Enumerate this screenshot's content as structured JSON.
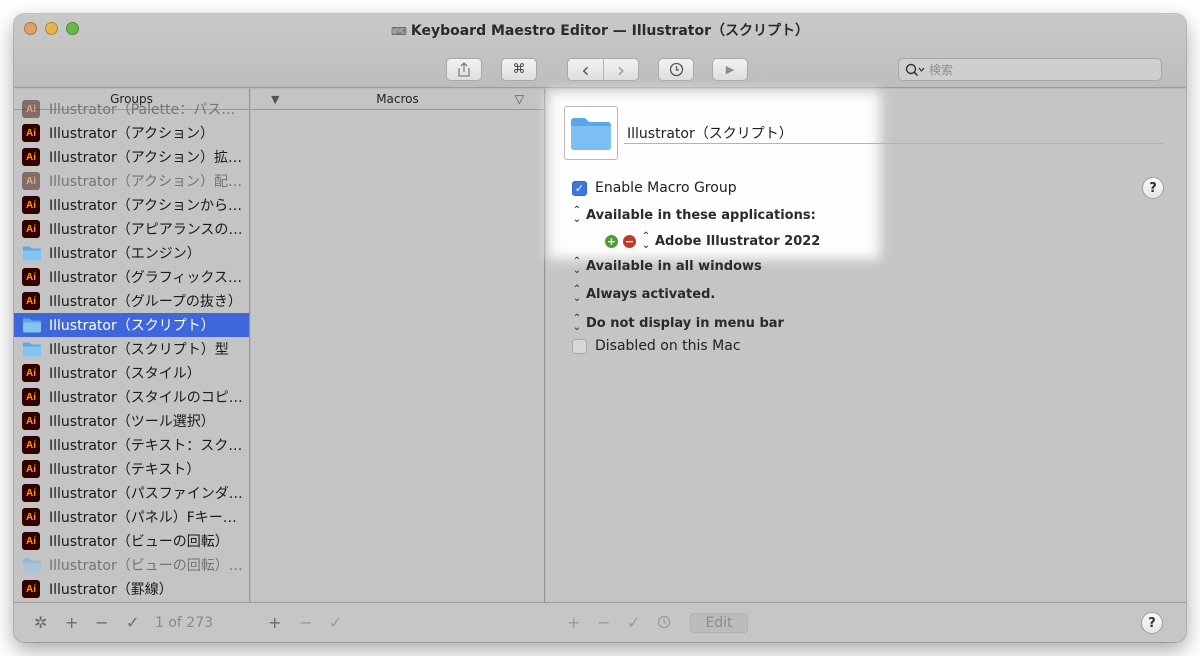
{
  "window": {
    "title": "Keyboard Maestro Editor — Illustrator（スクリプト）"
  },
  "toolbar": {
    "share_icon": "share-icon",
    "command_icon": "⌘",
    "back_icon": "‹",
    "forward_icon": "›",
    "clock_icon": "clock-icon",
    "run_icon": "▶",
    "search_placeholder": "検索"
  },
  "groups": {
    "header": "Groups",
    "items": [
      {
        "label": "Illustrator（Palette：パス操作）",
        "icon": "ai",
        "dim": true
      },
      {
        "label": "Illustrator（アクション）",
        "icon": "ai"
      },
      {
        "label": "Illustrator（アクション）拡大…",
        "icon": "ai"
      },
      {
        "label": "Illustrator（アクション）配布用",
        "icon": "ai",
        "dim": true
      },
      {
        "label": "Illustrator（アクションからの脱…",
        "icon": "ai"
      },
      {
        "label": "Illustrator（アピアランスのコピ…",
        "icon": "ai"
      },
      {
        "label": "Illustrator（エンジン）",
        "icon": "folder"
      },
      {
        "label": "Illustrator（グラフィックスタイ…",
        "icon": "ai"
      },
      {
        "label": "Illustrator（グループの抜き）",
        "icon": "ai"
      },
      {
        "label": "Illustrator（スクリプト）",
        "icon": "folder",
        "selected": true
      },
      {
        "label": "Illustrator（スクリプト）型",
        "icon": "folder"
      },
      {
        "label": "Illustrator（スタイル）",
        "icon": "ai"
      },
      {
        "label": "Illustrator（スタイルのコピー&…",
        "icon": "ai"
      },
      {
        "label": "Illustrator（ツール選択）",
        "icon": "ai"
      },
      {
        "label": "Illustrator（テキスト：スクリプ…",
        "icon": "ai"
      },
      {
        "label": "Illustrator（テキスト）",
        "icon": "ai"
      },
      {
        "label": "Illustrator（パスファインダー）",
        "icon": "ai"
      },
      {
        "label": "Illustrator（パネル）Fキー代替",
        "icon": "ai"
      },
      {
        "label": "Illustrator（ビューの回転）",
        "icon": "ai"
      },
      {
        "label": "Illustrator（ビューの回転）ba…",
        "icon": "folder",
        "dim": true
      },
      {
        "label": "Illustrator（罫線）",
        "icon": "ai"
      }
    ],
    "ai_badge": "Ai"
  },
  "macros": {
    "header": "Macros",
    "left_glyph": "▼",
    "right_glyph": "▽"
  },
  "editor": {
    "group_name": "Illustrator（スクリプト）",
    "enable_label": "Enable Macro Group",
    "enable_checked": true,
    "available_apps_label": "Available in these applications:",
    "app_name": "Adobe Illustrator 2022",
    "windows_label": "Available in all windows",
    "activation_label": "Always activated.",
    "menu_label": "Do not display in menu bar",
    "disabled_label": "Disabled on this Mac",
    "disabled_checked": false,
    "help": "?"
  },
  "footer": {
    "count": "1 of 273",
    "edit_label": "Edit",
    "plus": "+",
    "minus": "−",
    "check": "✓",
    "help": "?"
  },
  "colors": {
    "selection": "#3f67d9",
    "ai_bg": "#330000",
    "ai_fg": "#ff9a00",
    "checkbox": "#3c77e0"
  }
}
